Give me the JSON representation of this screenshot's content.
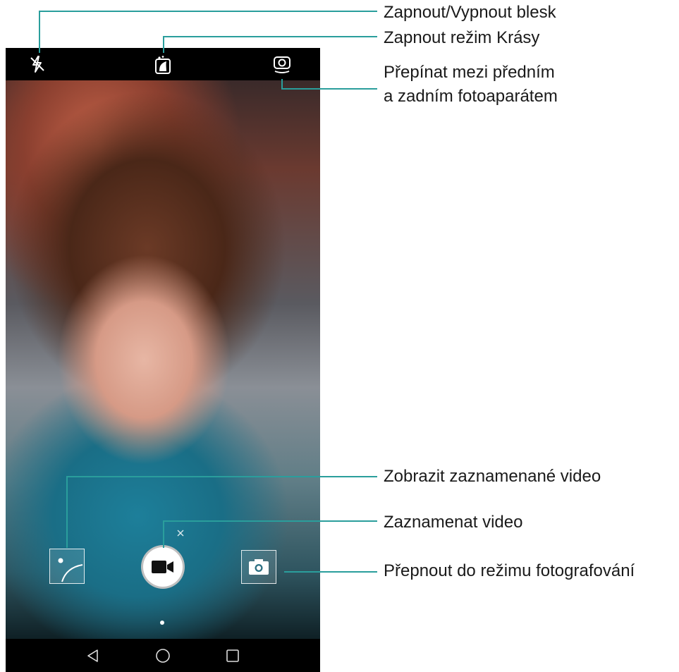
{
  "callouts": {
    "flash_toggle": "Zapnout/Vypnout blesk",
    "beauty_mode": "Zapnout režim Krásy",
    "switch_camera_line1": "Přepínat mezi předním",
    "switch_camera_line2": "a zadním fotoaparátem",
    "view_recorded_video": "Zobrazit zaznamenané video",
    "record_video": "Zaznamenat video",
    "switch_to_photo": "Přepnout do režimu fotografování"
  },
  "colors": {
    "callout_line": "#2a9e9c",
    "callout_text": "#1a1a1a",
    "bar_background": "#000000"
  },
  "icons": {
    "flash_off": "flash-off-icon",
    "beauty": "beauty-icon",
    "switch_camera": "switch-camera-icon",
    "gallery_thumbnail": "gallery-thumbnail-icon",
    "record": "video-camera-icon",
    "photo_mode": "camera-icon",
    "nav_back": "triangle-back-icon",
    "nav_home": "circle-home-icon",
    "nav_recents": "square-recents-icon"
  }
}
